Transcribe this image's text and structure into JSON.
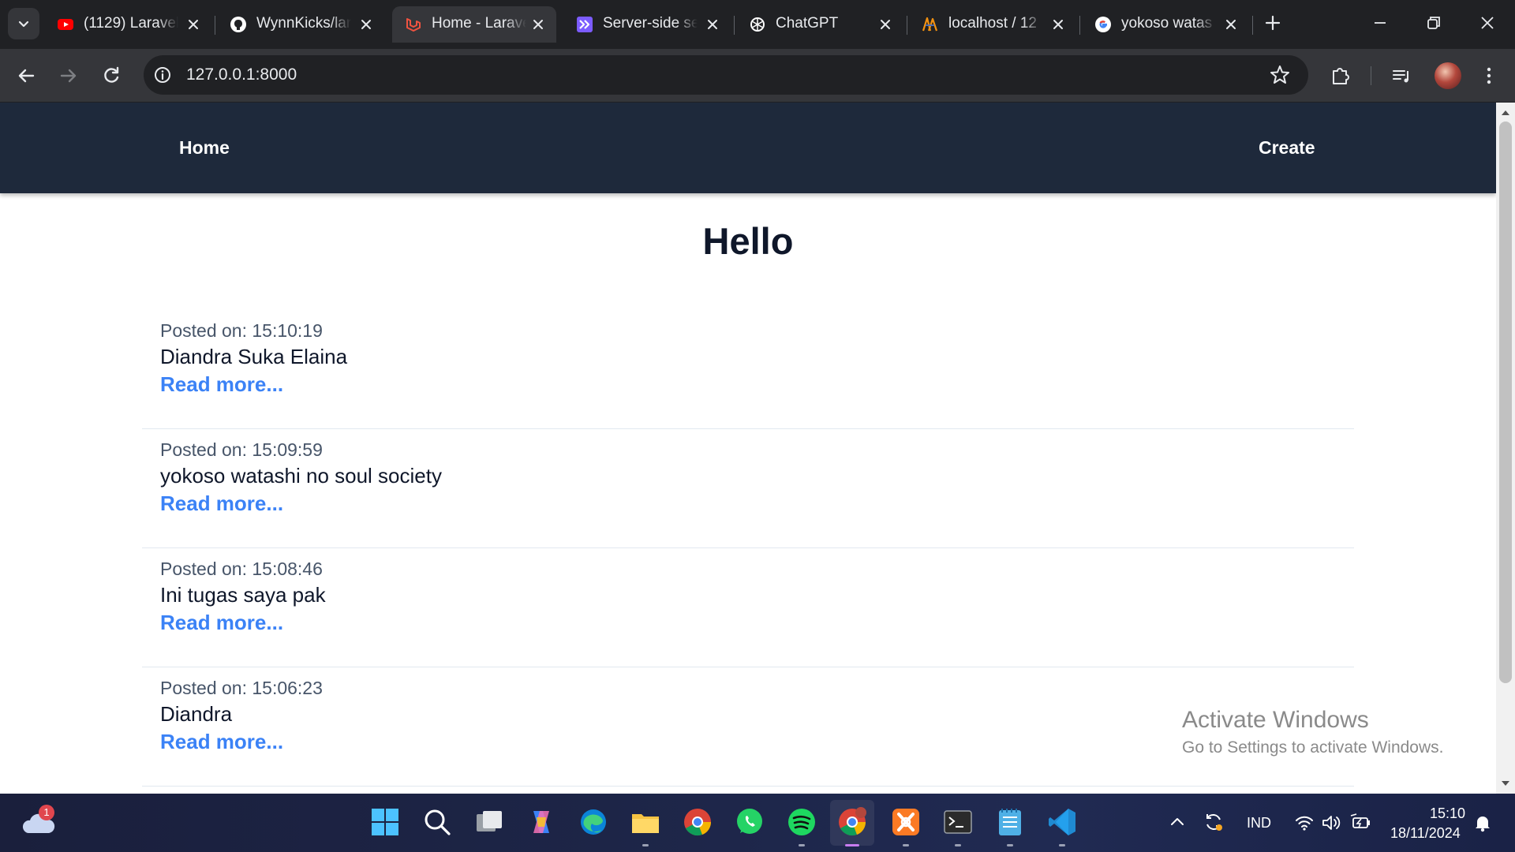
{
  "browser": {
    "tabs": [
      {
        "title": "(1129) Laravel",
        "icon": "youtube-icon",
        "color": "#ff0000"
      },
      {
        "title": "WynnKicks/lar",
        "icon": "github-icon",
        "color": "#ffffff"
      },
      {
        "title": "Home - Laravel",
        "icon": "laravel-icon",
        "color": "#f05340"
      },
      {
        "title": "Server-side se",
        "icon": "livewire-icon",
        "color": "#7c5cff"
      },
      {
        "title": "ChatGPT",
        "icon": "chatgpt-icon",
        "color": "#ffffff"
      },
      {
        "title": "localhost / 12",
        "icon": "phpmyadmin-icon",
        "color": "#f29111"
      },
      {
        "title": "yokoso watas",
        "icon": "google-icon",
        "color": "#4285f4"
      }
    ],
    "url": "127.0.0.1:8000"
  },
  "nav": {
    "home": "Home",
    "create": "Create"
  },
  "page": {
    "heading": "Hello",
    "posts": [
      {
        "meta": "Posted on: 15:10:19",
        "title": "Diandra Suka Elaina",
        "more": "Read more..."
      },
      {
        "meta": "Posted on: 15:09:59",
        "title": "yokoso watashi no soul society",
        "more": "Read more..."
      },
      {
        "meta": "Posted on: 15:08:46",
        "title": "Ini tugas saya pak",
        "more": "Read more..."
      },
      {
        "meta": "Posted on: 15:06:23",
        "title": "Diandra",
        "more": "Read more..."
      }
    ]
  },
  "watermark": {
    "line1": "Activate Windows",
    "line2": "Go to Settings to activate Windows."
  },
  "taskbar": {
    "weather_badge": "1",
    "language": "IND",
    "time": "15:10",
    "date": "18/11/2024"
  }
}
